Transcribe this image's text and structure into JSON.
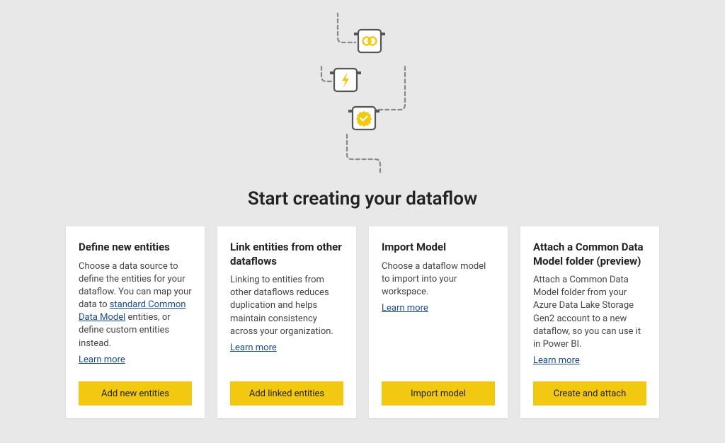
{
  "colors": {
    "accent_yellow": "#f2c811",
    "link_blue": "#1a4b8c",
    "background": "#e8e8e8",
    "card_bg": "#ffffff"
  },
  "illustration": {
    "icons": [
      "link-icon",
      "bolt-icon",
      "check-badge-icon"
    ]
  },
  "page_title": "Start creating your dataflow",
  "cards": [
    {
      "title": "Define new entities",
      "desc_before": "Choose a data source to define the entities for your dataflow. You can map your data to ",
      "inline_link": "standard Common Data Model",
      "desc_after": " entities, or define custom entities instead.",
      "learn_more": "Learn more",
      "button": "Add new entities"
    },
    {
      "title": "Link entities from other dataflows",
      "desc_before": "Linking to entities from other dataflows reduces duplication and helps maintain consistency across your organization.",
      "inline_link": "",
      "desc_after": "",
      "learn_more": "Learn more",
      "button": "Add linked entities"
    },
    {
      "title": "Import Model",
      "desc_before": "Choose a dataflow model to import into your workspace.",
      "inline_link": "",
      "desc_after": "",
      "learn_more": "Learn more",
      "button": "Import model"
    },
    {
      "title": "Attach a Common Data Model folder (preview)",
      "desc_before": "Attach a Common Data Model folder from your Azure Data Lake Storage Gen2 account to a new dataflow, so you can use it in Power BI.",
      "inline_link": "",
      "desc_after": "",
      "learn_more": "Learn more",
      "button": "Create and attach"
    }
  ]
}
